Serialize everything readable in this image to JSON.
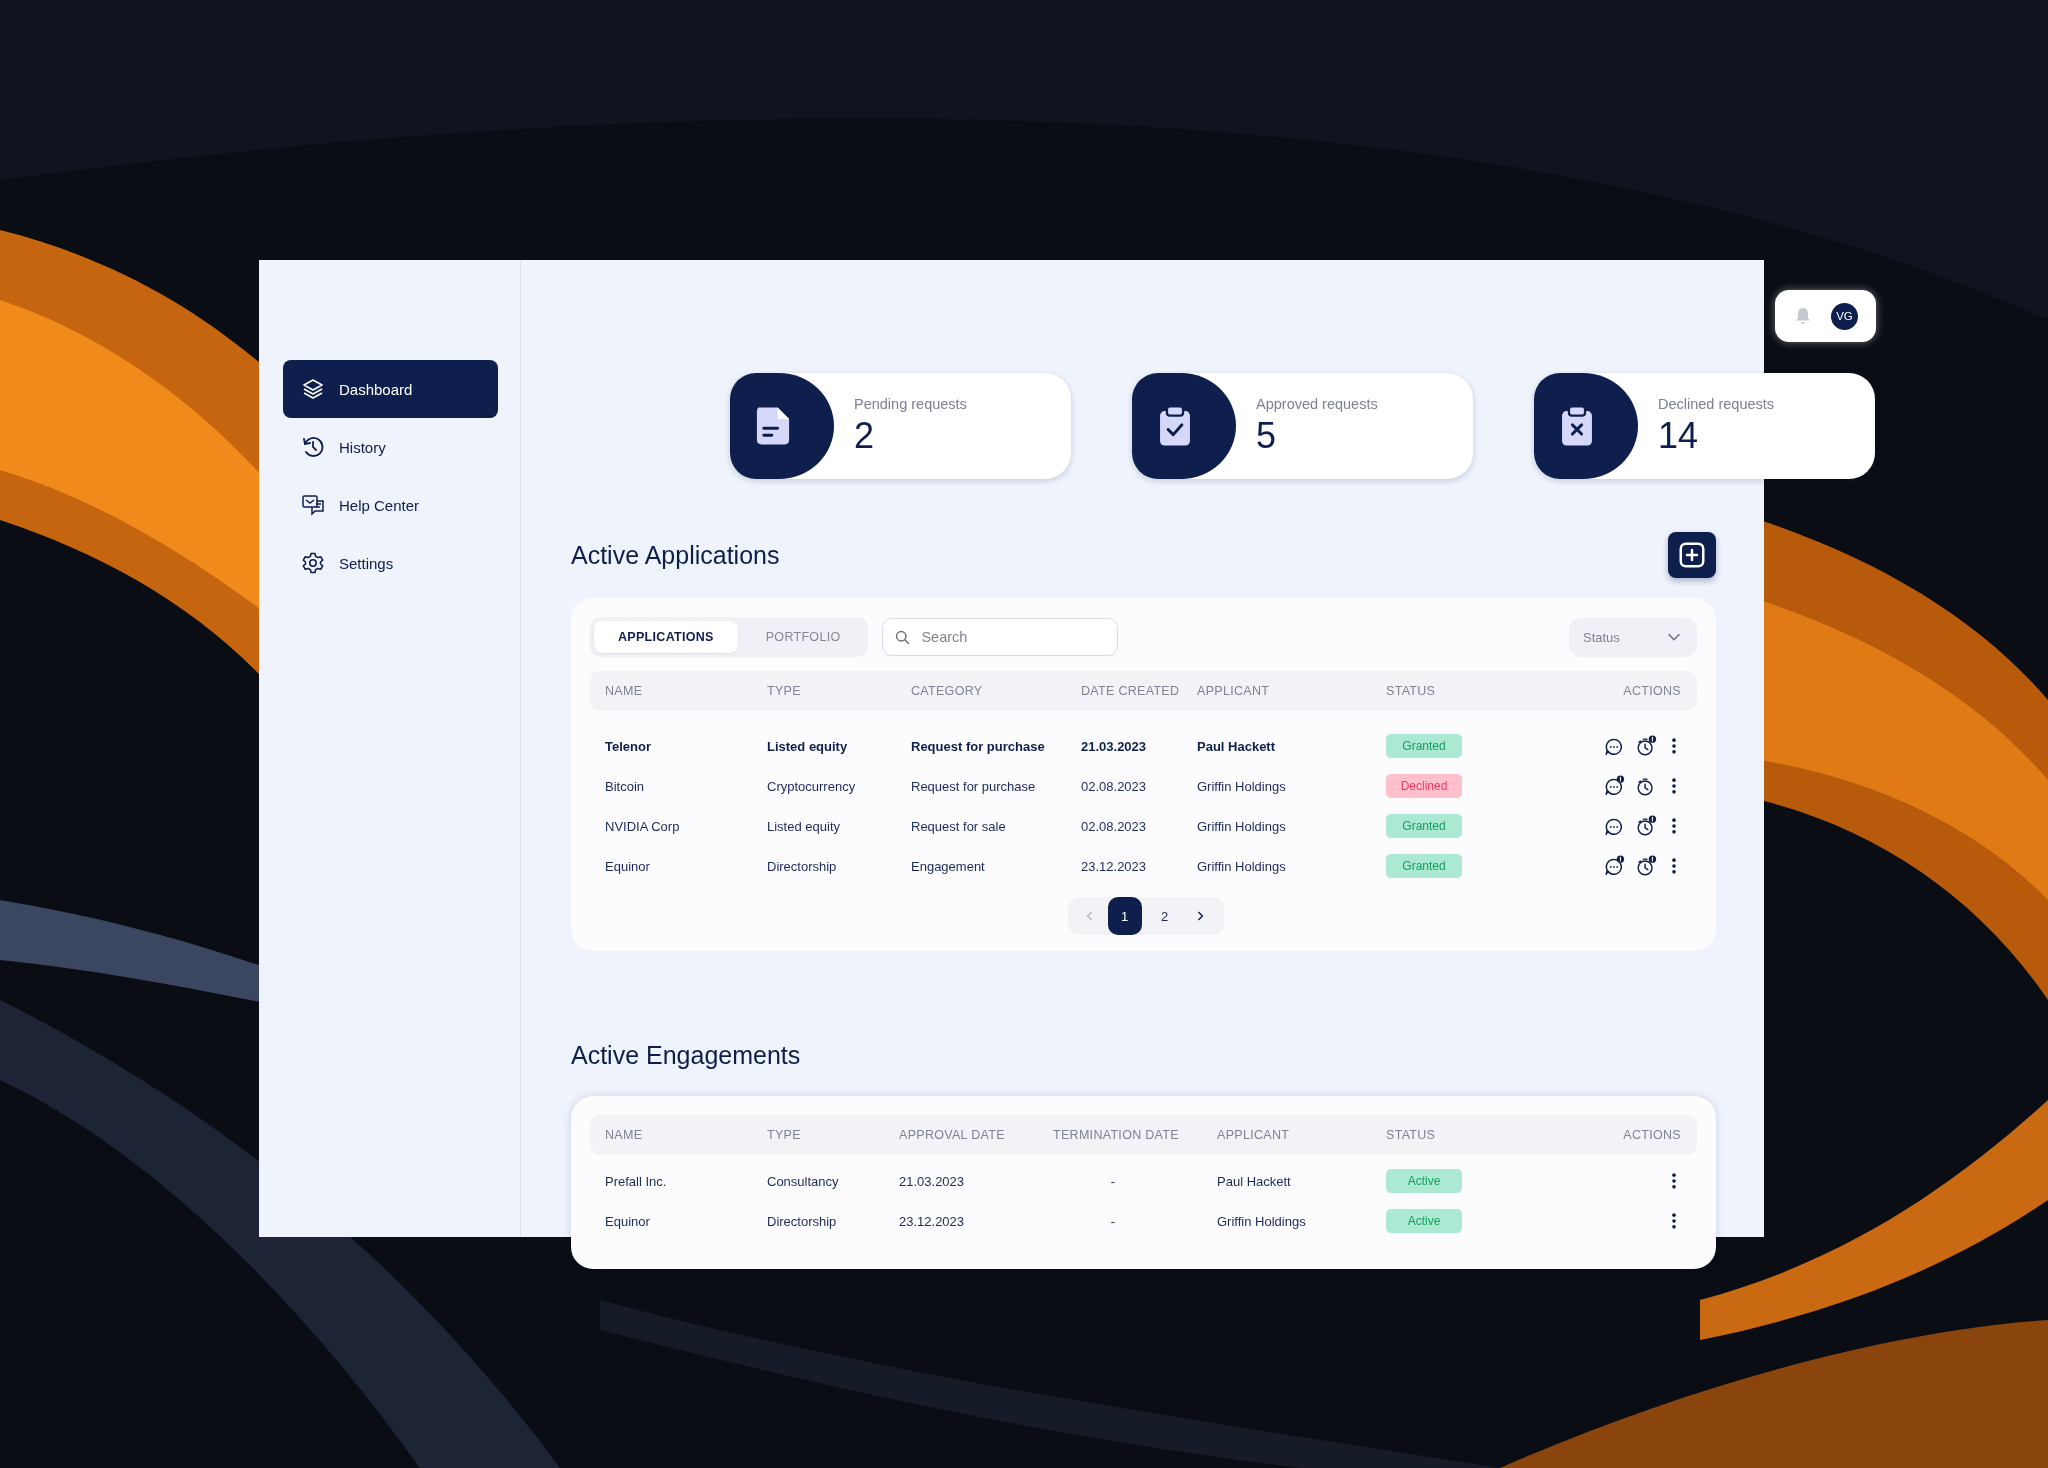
{
  "sidebar": {
    "items": [
      {
        "label": "Dashboard",
        "kind": "layers",
        "selected": true
      },
      {
        "label": "History",
        "kind": "history",
        "selected": false
      },
      {
        "label": "Help Center",
        "kind": "help",
        "selected": false
      },
      {
        "label": "Settings",
        "kind": "settings",
        "selected": false
      }
    ]
  },
  "user": {
    "initials": "VG"
  },
  "stats": [
    {
      "label": "Pending requests",
      "value": "2",
      "kind": "pending"
    },
    {
      "label": "Approved requests",
      "value": "5",
      "kind": "approved"
    },
    {
      "label": "Declined requests",
      "value": "14",
      "kind": "declined"
    }
  ],
  "applications": {
    "title": "Active Applications",
    "tabs": [
      {
        "label": "APPLICATIONS",
        "selected": true
      },
      {
        "label": "PORTFOLIO",
        "selected": false
      }
    ],
    "search": {
      "placeholder": "Search"
    },
    "status_filter": {
      "placeholder": "Status"
    },
    "columns": [
      "NAME",
      "TYPE",
      "CATEGORY",
      "DATE CREATED",
      "APPLICANT",
      "STATUS",
      "ACTIONS"
    ],
    "rows": [
      {
        "name": "Telenor",
        "type": "Listed equity",
        "category": "Request for purchase",
        "date_created": "21.03.2023",
        "applicant": "Paul Hackett",
        "status": "Granted",
        "kind": "granted",
        "unread": true,
        "chat_alert": false,
        "timer_alert": true
      },
      {
        "name": "Bitcoin",
        "type": "Cryptocurrency",
        "category": "Request for purchase",
        "date_created": "02.08.2023",
        "applicant": "Griffin Holdings",
        "status": "Declined",
        "kind": "declined",
        "unread": false,
        "chat_alert": true,
        "timer_alert": false
      },
      {
        "name": "NVIDIA Corp",
        "type": "Listed equity",
        "category": "Request for sale",
        "date_created": "02.08.2023",
        "applicant": "Griffin Holdings",
        "status": "Granted",
        "kind": "granted",
        "unread": false,
        "chat_alert": false,
        "timer_alert": true
      },
      {
        "name": "Equinor",
        "type": "Directorship",
        "category": "Engagement",
        "date_created": "23.12.2023",
        "applicant": "Griffin Holdings",
        "status": "Granted",
        "kind": "granted",
        "unread": false,
        "chat_alert": true,
        "timer_alert": true
      }
    ],
    "pagination": {
      "prev_disabled": true,
      "next_disabled": false,
      "pages": [
        {
          "label": "1",
          "selected": true
        },
        {
          "label": "2",
          "selected": false
        }
      ]
    }
  },
  "engagements": {
    "title": "Active Engagements",
    "columns": [
      "NAME",
      "TYPE",
      "APPROVAL DATE",
      "TERMINATION  DATE",
      "APPLICANT",
      "STATUS",
      "ACTIONS"
    ],
    "rows": [
      {
        "name": "Prefall Inc.",
        "type": "Consultancy",
        "approval_date": "21.03.2023",
        "termination_date": "-",
        "applicant": "Paul Hackett",
        "status": "Active",
        "kind": "active"
      },
      {
        "name": "Equinor",
        "type": "Directorship",
        "approval_date": "23.12.2023",
        "termination_date": "-",
        "applicant": "Griffin Holdings",
        "status": "Active",
        "kind": "active"
      }
    ]
  }
}
